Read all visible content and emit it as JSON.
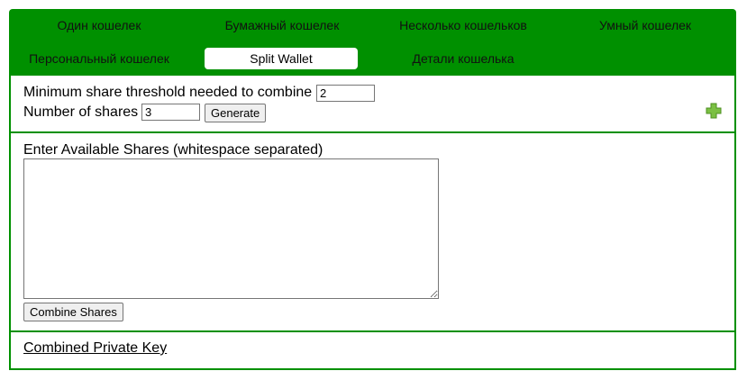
{
  "tabs": {
    "row1": [
      "Один кошелек",
      "Бумажный кошелек",
      "Несколько кошельков",
      "Умный кошелек"
    ],
    "row2": [
      "Персональный кошелек",
      "Split Wallet",
      "Детали кошелька"
    ]
  },
  "split": {
    "threshold_label": "Minimum share threshold needed to combine",
    "threshold_value": "2",
    "shares_label": "Number of shares",
    "shares_value": "3",
    "generate_label": "Generate"
  },
  "combine": {
    "shares_label": "Enter Available Shares (whitespace separated)",
    "shares_value": "",
    "combine_label": "Combine Shares"
  },
  "result": {
    "private_key_label": "Combined Private Key"
  },
  "colors": {
    "accent": "#009000",
    "plus": "#7bc043"
  },
  "icons": {
    "add": "plus-icon"
  }
}
